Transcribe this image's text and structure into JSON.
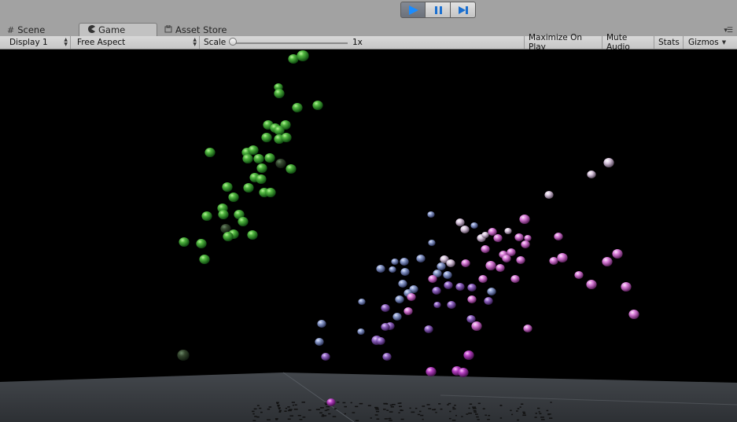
{
  "toolbar_play": {
    "play_icon": "play-icon",
    "pause_icon": "pause-icon",
    "step_icon": "step-icon",
    "accent": "#1a8cff"
  },
  "tabs": [
    {
      "label": "Scene",
      "icon": "grid-icon",
      "active": false
    },
    {
      "label": "Game",
      "icon": "pacman-icon",
      "active": true
    },
    {
      "label": "Asset Store",
      "icon": "store-icon",
      "active": false
    }
  ],
  "game_toolbar": {
    "display": "Display 1",
    "aspect": "Free Aspect",
    "scale_label": "Scale",
    "scale_value": "1x",
    "scale_fraction": 0.0,
    "maximize": "Maximize On Play",
    "mute": "Mute Audio",
    "stats": "Stats",
    "gizmos": "Gizmos"
  },
  "scene": {
    "background": "#000000",
    "floor_color": "#3b3e42",
    "green_sphere_color": "#3fa63a",
    "violet_sphere_color": "#9a66c8",
    "pink_sphere_color": "#d870d8",
    "blue_sphere_color": "#7f90c8"
  }
}
